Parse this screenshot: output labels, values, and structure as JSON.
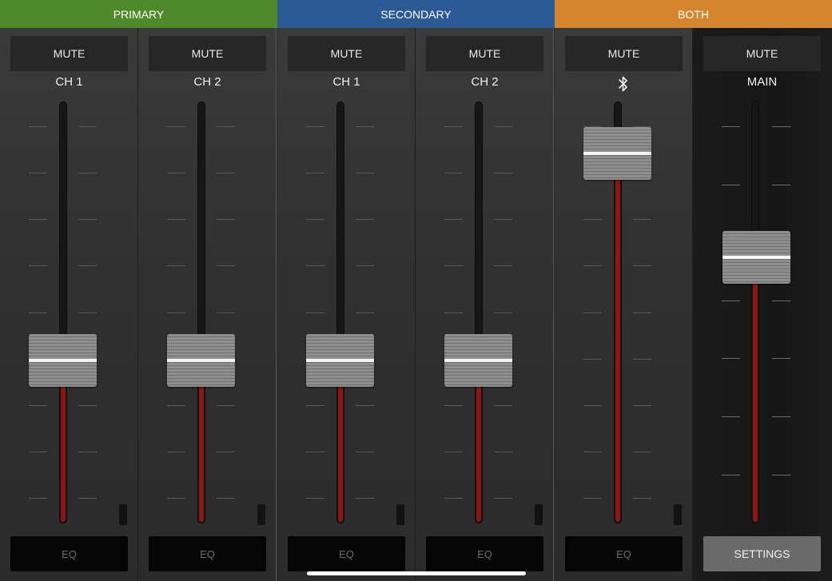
{
  "groups": [
    {
      "label": "PRIMARY",
      "color": "#4e8a2a"
    },
    {
      "label": "SECONDARY",
      "color": "#2c5a95"
    },
    {
      "label": "BOTH",
      "color": "#d4862e"
    }
  ],
  "strips": [
    {
      "mute_label": "MUTE",
      "name": "CH 1",
      "eq_label": "EQ",
      "fader_level": 0.37
    },
    {
      "mute_label": "MUTE",
      "name": "CH 2",
      "eq_label": "EQ",
      "fader_level": 0.37
    },
    {
      "mute_label": "MUTE",
      "name": "CH 1",
      "eq_label": "EQ",
      "fader_level": 0.37
    },
    {
      "mute_label": "MUTE",
      "name": "CH 2",
      "eq_label": "EQ",
      "fader_level": 0.37
    },
    {
      "mute_label": "MUTE",
      "icon": "bluetooth-icon",
      "eq_label": "EQ",
      "fader_level": 0.93
    },
    {
      "mute_label": "MUTE",
      "name": "MAIN",
      "settings_label": "SETTINGS",
      "fader_level": 0.65
    }
  ],
  "colors": {
    "fader_fill": "#8a1512",
    "primary": "#4e8a2a",
    "secondary": "#2c5a95",
    "both": "#d4862e"
  }
}
